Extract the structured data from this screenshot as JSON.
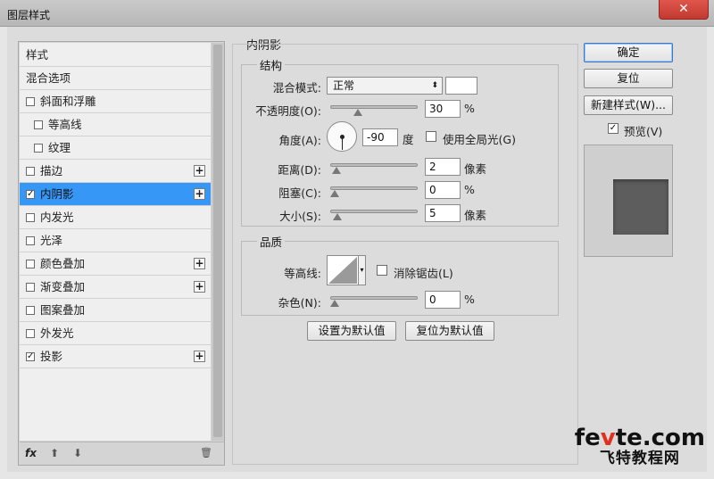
{
  "window": {
    "title": "图层样式",
    "close_label": "✕"
  },
  "layer_list": {
    "items": [
      {
        "label": "样式",
        "checkbox": false,
        "checked": false,
        "plus": false,
        "active": false,
        "indent": 0
      },
      {
        "label": "混合选项",
        "checkbox": false,
        "checked": false,
        "plus": false,
        "active": false,
        "indent": 0
      },
      {
        "label": "斜面和浮雕",
        "checkbox": true,
        "checked": false,
        "plus": false,
        "active": false,
        "indent": 0
      },
      {
        "label": "等高线",
        "checkbox": true,
        "checked": false,
        "plus": false,
        "active": false,
        "indent": 1
      },
      {
        "label": "纹理",
        "checkbox": true,
        "checked": false,
        "plus": false,
        "active": false,
        "indent": 1
      },
      {
        "label": "描边",
        "checkbox": true,
        "checked": false,
        "plus": true,
        "active": false,
        "indent": 0
      },
      {
        "label": "内阴影",
        "checkbox": true,
        "checked": true,
        "plus": true,
        "active": true,
        "indent": 0
      },
      {
        "label": "内发光",
        "checkbox": true,
        "checked": false,
        "plus": false,
        "active": false,
        "indent": 0
      },
      {
        "label": "光泽",
        "checkbox": true,
        "checked": false,
        "plus": false,
        "active": false,
        "indent": 0
      },
      {
        "label": "颜色叠加",
        "checkbox": true,
        "checked": false,
        "plus": true,
        "active": false,
        "indent": 0
      },
      {
        "label": "渐变叠加",
        "checkbox": true,
        "checked": false,
        "plus": true,
        "active": false,
        "indent": 0
      },
      {
        "label": "图案叠加",
        "checkbox": true,
        "checked": false,
        "plus": false,
        "active": false,
        "indent": 0
      },
      {
        "label": "外发光",
        "checkbox": true,
        "checked": false,
        "plus": false,
        "active": false,
        "indent": 0
      },
      {
        "label": "投影",
        "checkbox": true,
        "checked": true,
        "plus": true,
        "active": false,
        "indent": 0
      }
    ],
    "footer": {
      "fx": "fx",
      "up": "⬆",
      "down": "⬇",
      "trash": "🗑"
    }
  },
  "inner_shadow": {
    "title": "内阴影",
    "structure": {
      "title": "结构",
      "blend_mode_label": "混合模式:",
      "blend_mode_value": "正常",
      "blend_mode_arrow": "⬍",
      "opacity_label": "不透明度(O):",
      "opacity_value": "30",
      "opacity_unit": "%",
      "angle_label": "角度(A):",
      "angle_value": "-90",
      "angle_unit": "度",
      "global_light_label": "使用全局光(G)",
      "global_light_checked": false,
      "distance_label": "距离(D):",
      "distance_value": "2",
      "distance_unit": "像素",
      "choke_label": "阻塞(C):",
      "choke_value": "0",
      "choke_unit": "%",
      "size_label": "大小(S):",
      "size_value": "5",
      "size_unit": "像素"
    },
    "quality": {
      "title": "品质",
      "contour_label": "等高线:",
      "antialias_label": "消除锯齿(L)",
      "antialias_checked": false,
      "noise_label": "杂色(N):",
      "noise_value": "0",
      "noise_unit": "%"
    },
    "set_default_label": "设置为默认值",
    "reset_default_label": "复位为默认值"
  },
  "slider_levels": {
    "opacity": 0.3,
    "distance": 0.02,
    "choke": 0.0,
    "size": 0.03,
    "noise": 0.0
  },
  "right_panel": {
    "ok_label": "确定",
    "reset_label": "复位",
    "new_style_label": "新建样式(W)...",
    "preview_label": "预览(V)",
    "preview_checked": true
  },
  "watermark": {
    "line1_a": "fe",
    "line1_b": "v",
    "line1_c": "te.com",
    "line2": "飞特教程网"
  },
  "colors": {
    "accent": "#3797f6",
    "preview_swatch": "#5d5d5d"
  }
}
